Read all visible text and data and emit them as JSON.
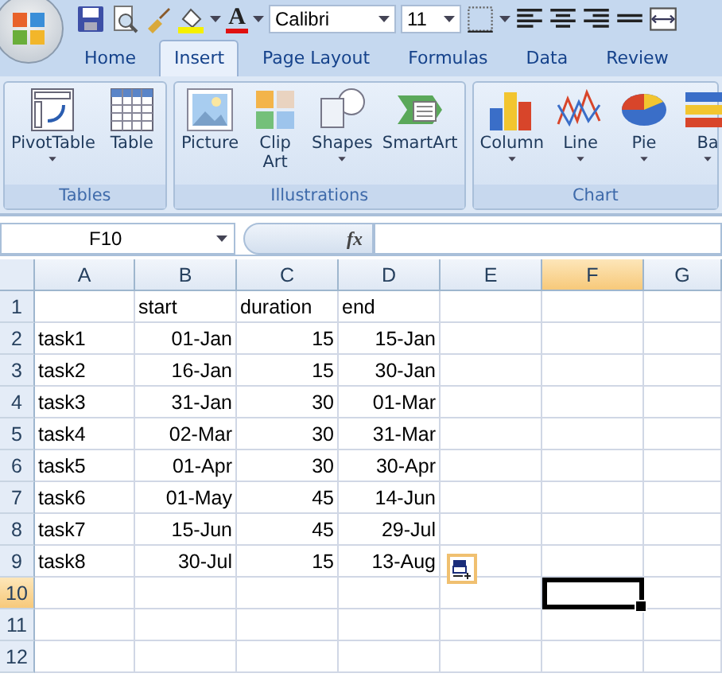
{
  "quick_access": {
    "font_color_glyph": "A",
    "font_name": "Calibri",
    "font_size": "11"
  },
  "tabs": [
    {
      "label": "Home",
      "selected": false
    },
    {
      "label": "Insert",
      "selected": true
    },
    {
      "label": "Page Layout",
      "selected": false
    },
    {
      "label": "Formulas",
      "selected": false
    },
    {
      "label": "Data",
      "selected": false
    },
    {
      "label": "Review",
      "selected": false
    }
  ],
  "ribbon_groups": [
    {
      "label": "Tables",
      "buttons": [
        {
          "label": "PivotTable",
          "kind": "pivot",
          "dropdown": true
        },
        {
          "label": "Table",
          "kind": "table",
          "dropdown": false
        }
      ]
    },
    {
      "label": "Illustrations",
      "buttons": [
        {
          "label": "Picture",
          "kind": "picture",
          "dropdown": false
        },
        {
          "label": "Clip Art",
          "kind": "clipart",
          "dropdown": false
        },
        {
          "label": "Shapes",
          "kind": "shapes",
          "dropdown": true
        },
        {
          "label": "SmartArt",
          "kind": "smartart",
          "dropdown": false
        }
      ]
    },
    {
      "label": "Chart",
      "buttons": [
        {
          "label": "Column",
          "kind": "column",
          "dropdown": true
        },
        {
          "label": "Line",
          "kind": "line",
          "dropdown": true
        },
        {
          "label": "Pie",
          "kind": "pie",
          "dropdown": true
        },
        {
          "label": "Ba",
          "kind": "bar",
          "dropdown": true
        }
      ]
    }
  ],
  "formula_bar": {
    "name_box": "F10",
    "function_label": "fx"
  },
  "sheet": {
    "columns": [
      {
        "label": "A",
        "selected": false
      },
      {
        "label": "B",
        "selected": false
      },
      {
        "label": "C",
        "selected": false
      },
      {
        "label": "D",
        "selected": false
      },
      {
        "label": "E",
        "selected": false
      },
      {
        "label": "F",
        "selected": true
      },
      {
        "label": "G",
        "selected": false
      }
    ],
    "rows": [
      {
        "label": "1",
        "selected": false,
        "kind": "header",
        "cells": [
          null,
          "start",
          "duration",
          "end"
        ]
      },
      {
        "label": "2",
        "selected": false,
        "kind": "data",
        "cells": [
          "task1",
          "01-Jan",
          "15",
          "15-Jan"
        ]
      },
      {
        "label": "3",
        "selected": false,
        "kind": "data",
        "cells": [
          "task2",
          "16-Jan",
          "15",
          "30-Jan"
        ]
      },
      {
        "label": "4",
        "selected": false,
        "kind": "data",
        "cells": [
          "task3",
          "31-Jan",
          "30",
          "01-Mar"
        ]
      },
      {
        "label": "5",
        "selected": false,
        "kind": "data",
        "cells": [
          "task4",
          "02-Mar",
          "30",
          "31-Mar"
        ]
      },
      {
        "label": "6",
        "selected": false,
        "kind": "data",
        "cells": [
          "task5",
          "01-Apr",
          "30",
          "30-Apr"
        ]
      },
      {
        "label": "7",
        "selected": false,
        "kind": "data",
        "cells": [
          "task6",
          "01-May",
          "45",
          "14-Jun"
        ]
      },
      {
        "label": "8",
        "selected": false,
        "kind": "data",
        "cells": [
          "task7",
          "15-Jun",
          "45",
          "29-Jul"
        ]
      },
      {
        "label": "9",
        "selected": false,
        "kind": "data",
        "cells": [
          "task8",
          "30-Jul",
          "15",
          "13-Aug"
        ]
      },
      {
        "label": "10",
        "selected": true,
        "kind": "data",
        "cells": []
      },
      {
        "label": "11",
        "selected": false,
        "kind": "data",
        "cells": []
      },
      {
        "label": "12",
        "selected": false,
        "kind": "data",
        "cells": []
      }
    ]
  }
}
